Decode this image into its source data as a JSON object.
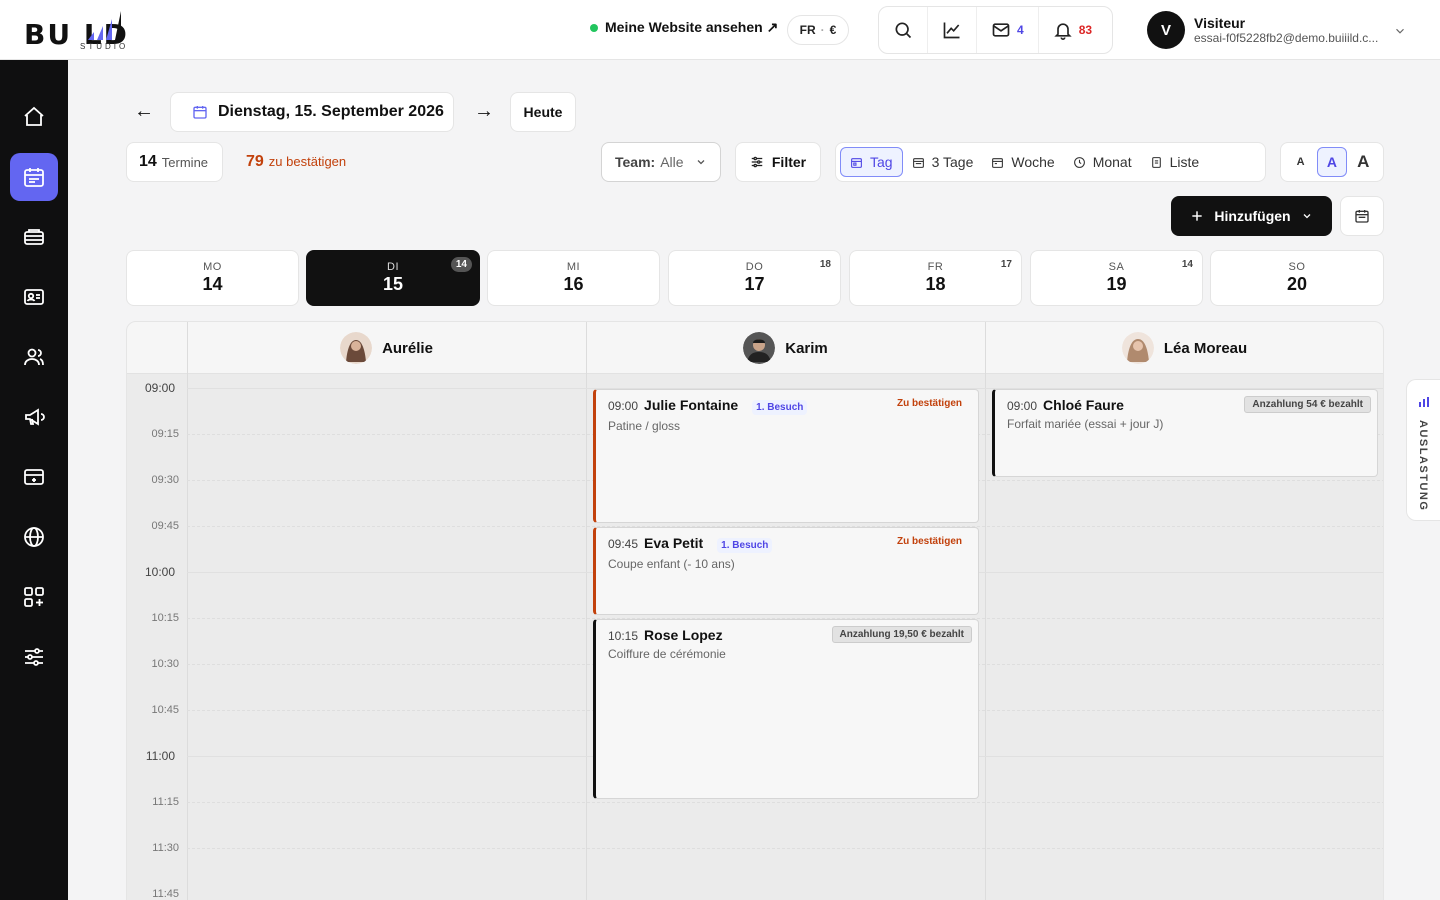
{
  "brand": {
    "name": "BU LD",
    "sub": "STUDIO"
  },
  "header": {
    "site_link": "Meine Website ansehen ↗",
    "locale_lang": "FR",
    "locale_sep": "·",
    "locale_currency": "€",
    "messages_count": "4",
    "notifications_count": "83",
    "user": {
      "initial": "V",
      "name": "Visiteur",
      "email": "essai-f0f5228fb2@demo.buiiild.c..."
    }
  },
  "sidebar": {
    "items": [
      {
        "icon": "home-icon"
      },
      {
        "icon": "calendar-icon",
        "active": true
      },
      {
        "icon": "inbox-icon"
      },
      {
        "icon": "contact-card-icon"
      },
      {
        "icon": "users-icon"
      },
      {
        "icon": "megaphone-icon"
      },
      {
        "icon": "payment-card-icon"
      },
      {
        "icon": "globe-icon"
      },
      {
        "icon": "apps-add-icon"
      },
      {
        "icon": "sliders-icon"
      }
    ]
  },
  "toolbar": {
    "prev": "←",
    "next": "→",
    "date": "Dienstag, 15. September 2026",
    "today": "Heute",
    "appointments_count": "14",
    "appointments_label": "Termine",
    "pending_count": "79",
    "pending_label": "zu bestätigen",
    "team_label": "Team:",
    "team_value": "Alle",
    "filter": "Filter",
    "views": [
      {
        "label": "Tag",
        "icon": "calendar-day-icon",
        "active": true
      },
      {
        "label": "3 Tage",
        "icon": "calendar-3days-icon"
      },
      {
        "label": "Woche",
        "icon": "calendar-week-icon"
      },
      {
        "label": "Monat",
        "icon": "clock-icon"
      },
      {
        "label": "Liste",
        "icon": "list-icon"
      }
    ],
    "sizes": [
      "A",
      "A",
      "A"
    ],
    "add": "Hinzufügen"
  },
  "days": [
    {
      "name": "MO",
      "date": "14",
      "count": ""
    },
    {
      "name": "DI",
      "date": "15",
      "count": "14",
      "active": true
    },
    {
      "name": "MI",
      "date": "16",
      "count": ""
    },
    {
      "name": "DO",
      "date": "17",
      "count": "18"
    },
    {
      "name": "FR",
      "date": "18",
      "count": "17"
    },
    {
      "name": "SA",
      "date": "19",
      "count": "14"
    },
    {
      "name": "SO",
      "date": "20",
      "count": ""
    }
  ],
  "staff": [
    {
      "name": "Aurélie",
      "avatar_color": "#6b4a3a"
    },
    {
      "name": "Karim",
      "avatar_color": "#2b2b2b"
    },
    {
      "name": "Léa Moreau",
      "avatar_color": "#b08a6e"
    }
  ],
  "times": [
    "09:00",
    "09:15",
    "09:30",
    "09:45",
    "10:00",
    "10:15",
    "10:30",
    "10:45",
    "11:00",
    "11:15",
    "11:30",
    "11:45"
  ],
  "events": [
    {
      "time": "09:00",
      "name": "Julie Fontaine",
      "tag": "1. Besuch",
      "service": "Patine / gloss",
      "status": "Zu bestätigen"
    },
    {
      "time": "09:45",
      "name": "Eva Petit",
      "tag": "1. Besuch",
      "service": "Coupe enfant (- 10 ans)",
      "status": "Zu bestätigen"
    },
    {
      "time": "10:15",
      "name": "Rose Lopez",
      "service": "Coiffure de cérémonie",
      "paid": "Anzahlung 19,50 € bezahlt"
    },
    {
      "time": "09:00",
      "name": "Chloé Faure",
      "service": "Forfait mariée (essai + jour J)",
      "paid": "Anzahlung 54 € bezahlt"
    }
  ],
  "side_tab": "AUSLASTUNG",
  "colors": {
    "accent": "#6366f1",
    "warning": "#c2410c",
    "dark": "#111111"
  }
}
